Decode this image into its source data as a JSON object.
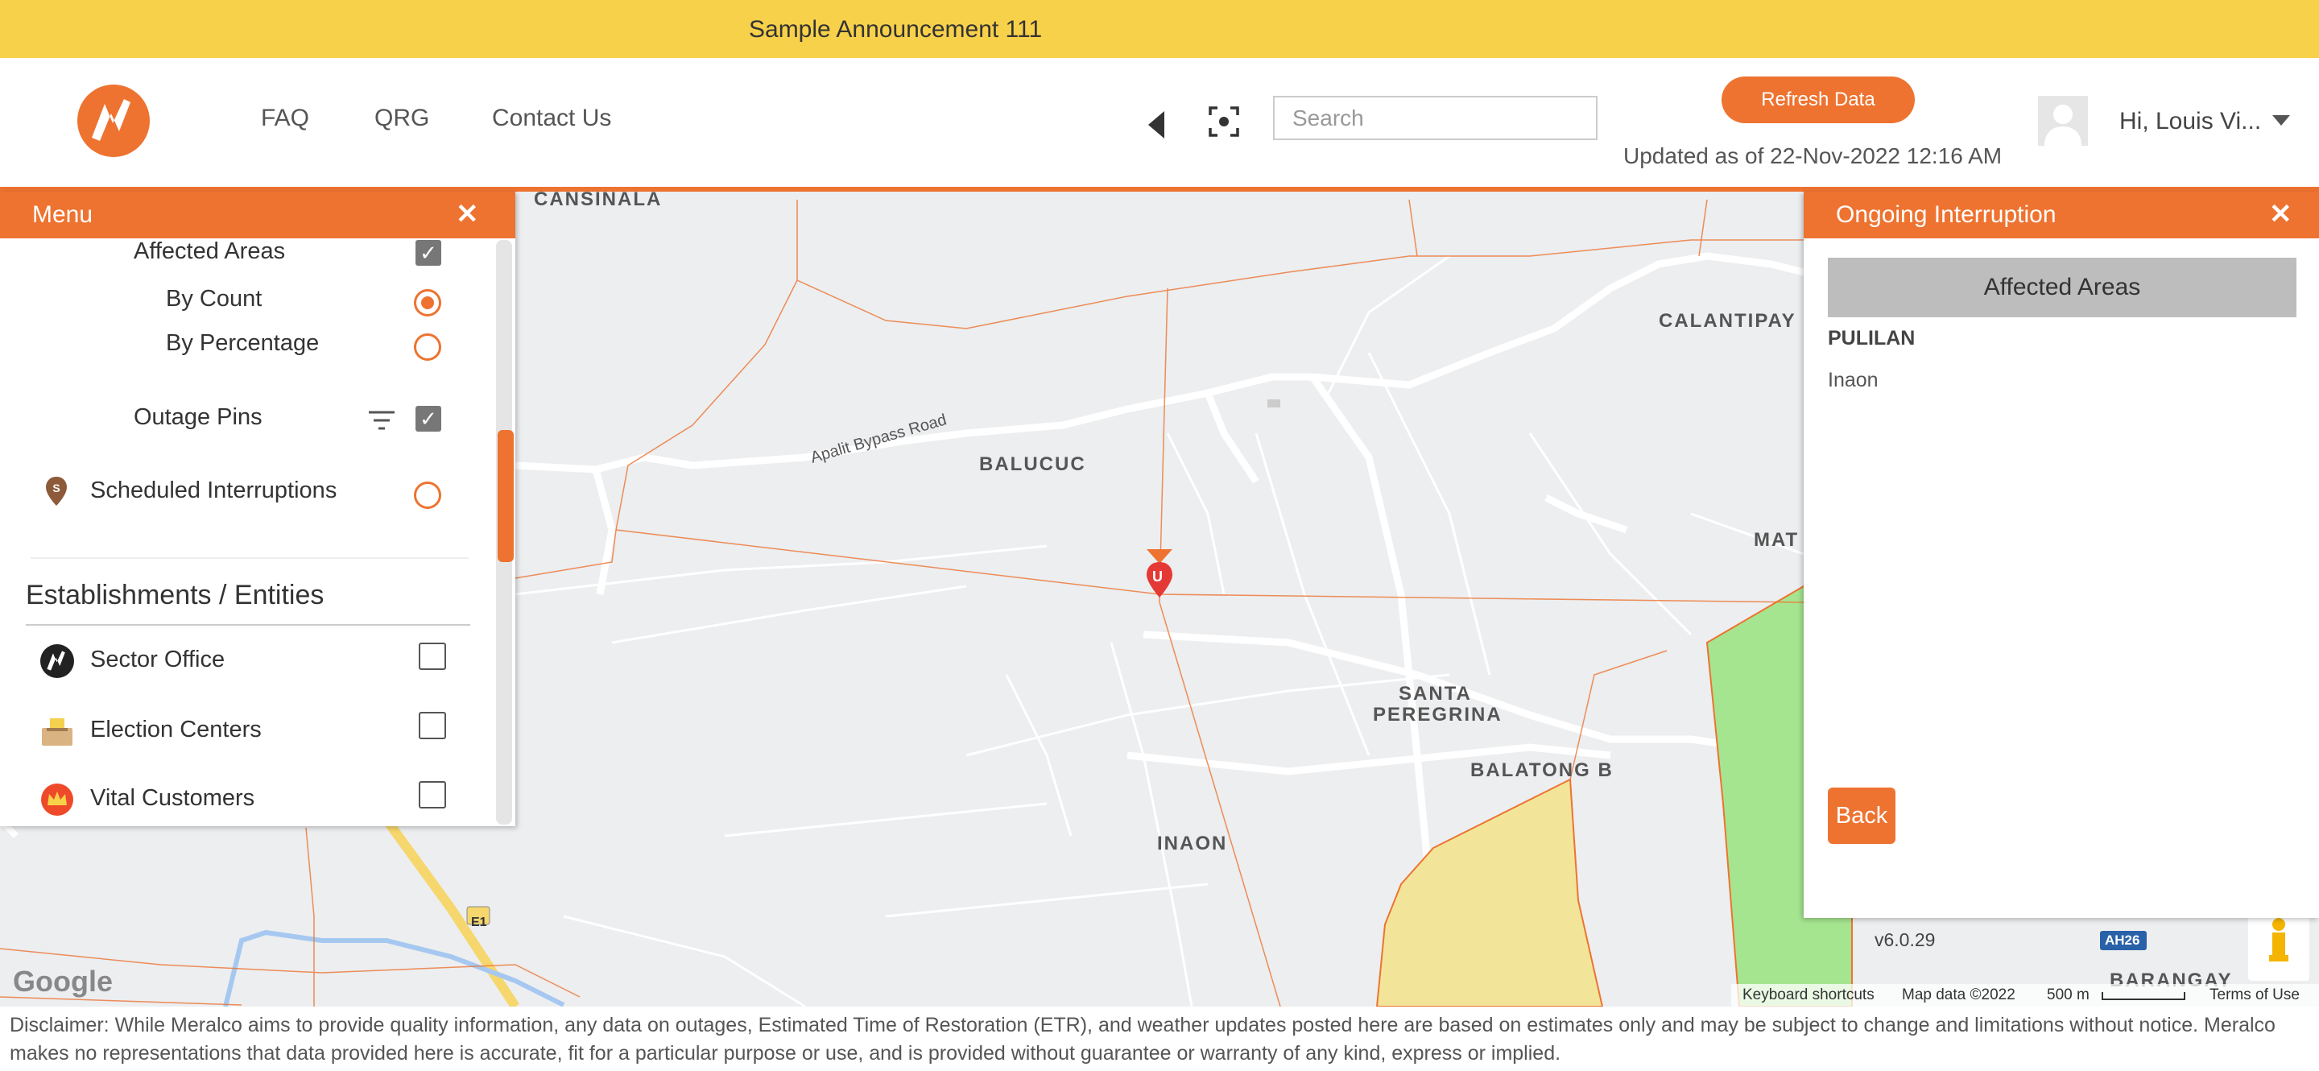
{
  "announcement": "Sample Announcement 111",
  "nav": {
    "faq": "FAQ",
    "qrg": "QRG",
    "contact": "Contact Us"
  },
  "search": {
    "placeholder": "Search"
  },
  "refresh_label": "Refresh Data",
  "updated_text": "Updated as of 22-Nov-2022 12:16 AM",
  "user_greeting": "Hi, Louis Vi...",
  "menu": {
    "title": "Menu",
    "affected_areas": {
      "label": "Affected Areas",
      "checked": true
    },
    "by_count": {
      "label": "By Count",
      "selected": true
    },
    "by_percentage": {
      "label": "By Percentage",
      "selected": false
    },
    "outage_pins": {
      "label": "Outage Pins",
      "checked": true
    },
    "scheduled": {
      "label": "Scheduled Interruptions",
      "selected": false
    },
    "section_title": "Establishments / Entities",
    "entities": [
      {
        "label": "Sector Office",
        "checked": false,
        "icon": "meralco-logo-icon"
      },
      {
        "label": "Election Centers",
        "checked": false,
        "icon": "ballot-box-icon"
      },
      {
        "label": "Vital Customers",
        "checked": false,
        "icon": "crown-icon"
      }
    ]
  },
  "ongoing": {
    "title": "Ongoing Interruption",
    "affected_areas_button": "Affected Areas",
    "city": "PULILAN",
    "barangay": "Inaon",
    "back_label": "Back"
  },
  "map": {
    "labels": {
      "cansinala": "CANSINALA",
      "calantipay": "CALANTIPAY",
      "balucuc": "BALUCUC",
      "mat": "MAT",
      "santa": "SANTA",
      "peregrina": "PEREGRINA",
      "balatong": "BALATONG B",
      "inaon": "INAON",
      "barangay": "BARANGAY",
      "road": "Apalit Bypass Road",
      "e1": "E1",
      "ah26": "AH26"
    },
    "version": "v6.0.29",
    "google": "Google",
    "attribution": {
      "shortcuts": "Keyboard shortcuts",
      "data": "Map data ©2022",
      "scale": "500 m",
      "terms": "Terms of Use"
    },
    "pin_letter": "U",
    "colors": {
      "yellow_area": "#f2e59a",
      "green_area": "#a6e590",
      "boundary": "#ee7330"
    }
  },
  "disclaimer": "Disclaimer: While Meralco aims to provide quality information, any data on outages, Estimated Time of Restoration (ETR), and weather updates posted here are based on estimates only and may be subject to change and limitations without notice. Meralco makes no representations that data provided here is accurate, fit for a particular purpose or use, and is provided without guarantee or warranty of any kind, express or implied."
}
